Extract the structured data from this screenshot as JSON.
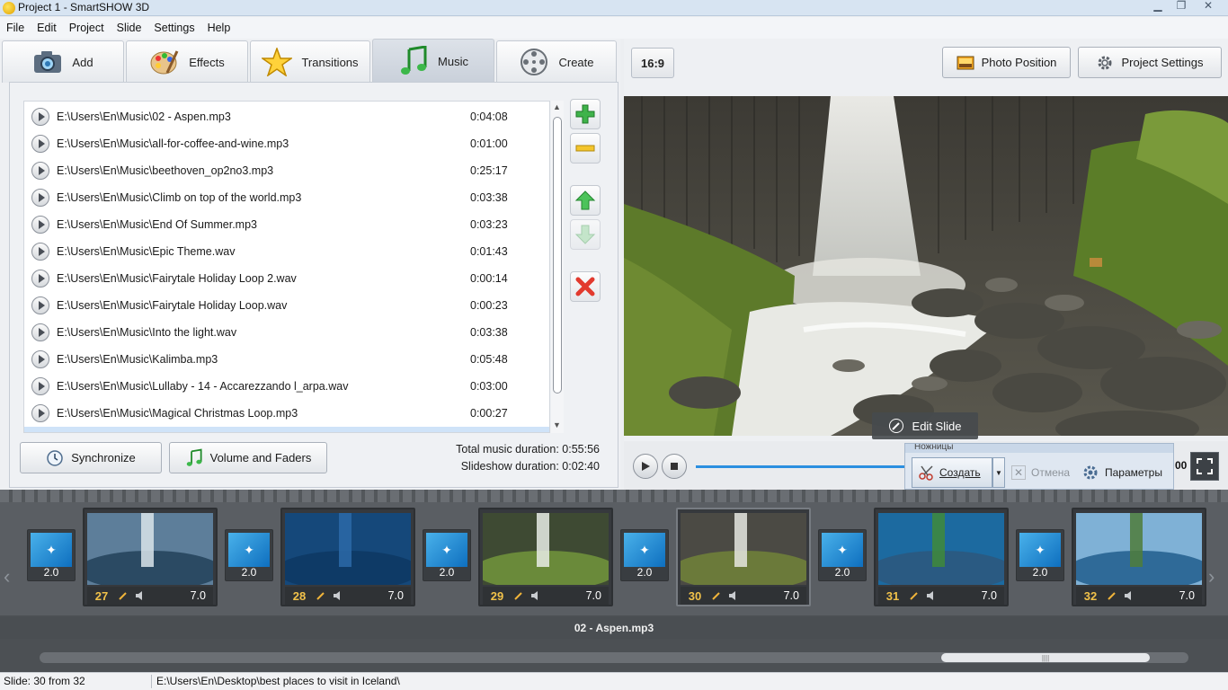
{
  "window": {
    "title": "Project 1 - SmartSHOW 3D"
  },
  "menu": [
    "File",
    "Edit",
    "Project",
    "Slide",
    "Settings",
    "Help"
  ],
  "tabs": [
    {
      "label": "Add",
      "icon": "camera-icon"
    },
    {
      "label": "Effects",
      "icon": "palette-icon"
    },
    {
      "label": "Transitions",
      "icon": "star-icon"
    },
    {
      "label": "Music",
      "icon": "music-note-icon",
      "active": true
    },
    {
      "label": "Create",
      "icon": "film-reel-icon"
    }
  ],
  "music": {
    "tracks": [
      {
        "path": "E:\\Users\\En\\Music\\02 - Aspen.mp3",
        "duration": "0:04:08"
      },
      {
        "path": "E:\\Users\\En\\Music\\all-for-coffee-and-wine.mp3",
        "duration": "0:01:00"
      },
      {
        "path": "E:\\Users\\En\\Music\\beethoven_op2no3.mp3",
        "duration": "0:25:17"
      },
      {
        "path": "E:\\Users\\En\\Music\\Climb on top of the world.mp3",
        "duration": "0:03:38"
      },
      {
        "path": "E:\\Users\\En\\Music\\End Of Summer.mp3",
        "duration": "0:03:23"
      },
      {
        "path": "E:\\Users\\En\\Music\\Epic Theme.wav",
        "duration": "0:01:43"
      },
      {
        "path": "E:\\Users\\En\\Music\\Fairytale Holiday Loop 2.wav",
        "duration": "0:00:14"
      },
      {
        "path": "E:\\Users\\En\\Music\\Fairytale Holiday Loop.wav",
        "duration": "0:00:23"
      },
      {
        "path": "E:\\Users\\En\\Music\\Into the light.wav",
        "duration": "0:03:38"
      },
      {
        "path": "E:\\Users\\En\\Music\\Kalimba.mp3",
        "duration": "0:05:48"
      },
      {
        "path": "E:\\Users\\En\\Music\\Lullaby - 14 - Accarezzando l_arpa.wav",
        "duration": "0:03:00"
      },
      {
        "path": "E:\\Users\\En\\Music\\Magical Christmas Loop.mp3",
        "duration": "0:00:27"
      }
    ],
    "synchronize_label": "Synchronize",
    "volume_label": "Volume and Faders",
    "total_music": "Total music duration: 0:55:56",
    "slideshow_duration": "Slideshow duration: 0:02:40"
  },
  "preview": {
    "ratio": "16:9",
    "photo_position_label": "Photo Position",
    "project_settings_label": "Project Settings",
    "edit_slide_label": "Edit Slide",
    "time_fragment": "00"
  },
  "snip_popup": {
    "title": "Ножницы",
    "create_label": "Создать",
    "cancel_label": "Отмена",
    "params_label": "Параметры"
  },
  "timeline": {
    "transitions": [
      "2.0",
      "2.0",
      "2.0",
      "2.0",
      "2.0",
      "2.0"
    ],
    "slides": [
      {
        "num": "27",
        "duration": "7.0"
      },
      {
        "num": "28",
        "duration": "7.0"
      },
      {
        "num": "29",
        "duration": "7.0"
      },
      {
        "num": "30",
        "duration": "7.0",
        "selected": true
      },
      {
        "num": "31",
        "duration": "7.0"
      },
      {
        "num": "32",
        "duration": "7.0"
      }
    ],
    "music_track": "02 - Aspen.mp3"
  },
  "status": {
    "slide": "Slide: 30 from 32",
    "path": "E:\\Users\\En\\Desktop\\best places to visit in Iceland\\"
  },
  "colors": {
    "accent": "#2b8fe0",
    "slide_number": "#f2c24a",
    "timeline_bg": "#4c5054"
  }
}
